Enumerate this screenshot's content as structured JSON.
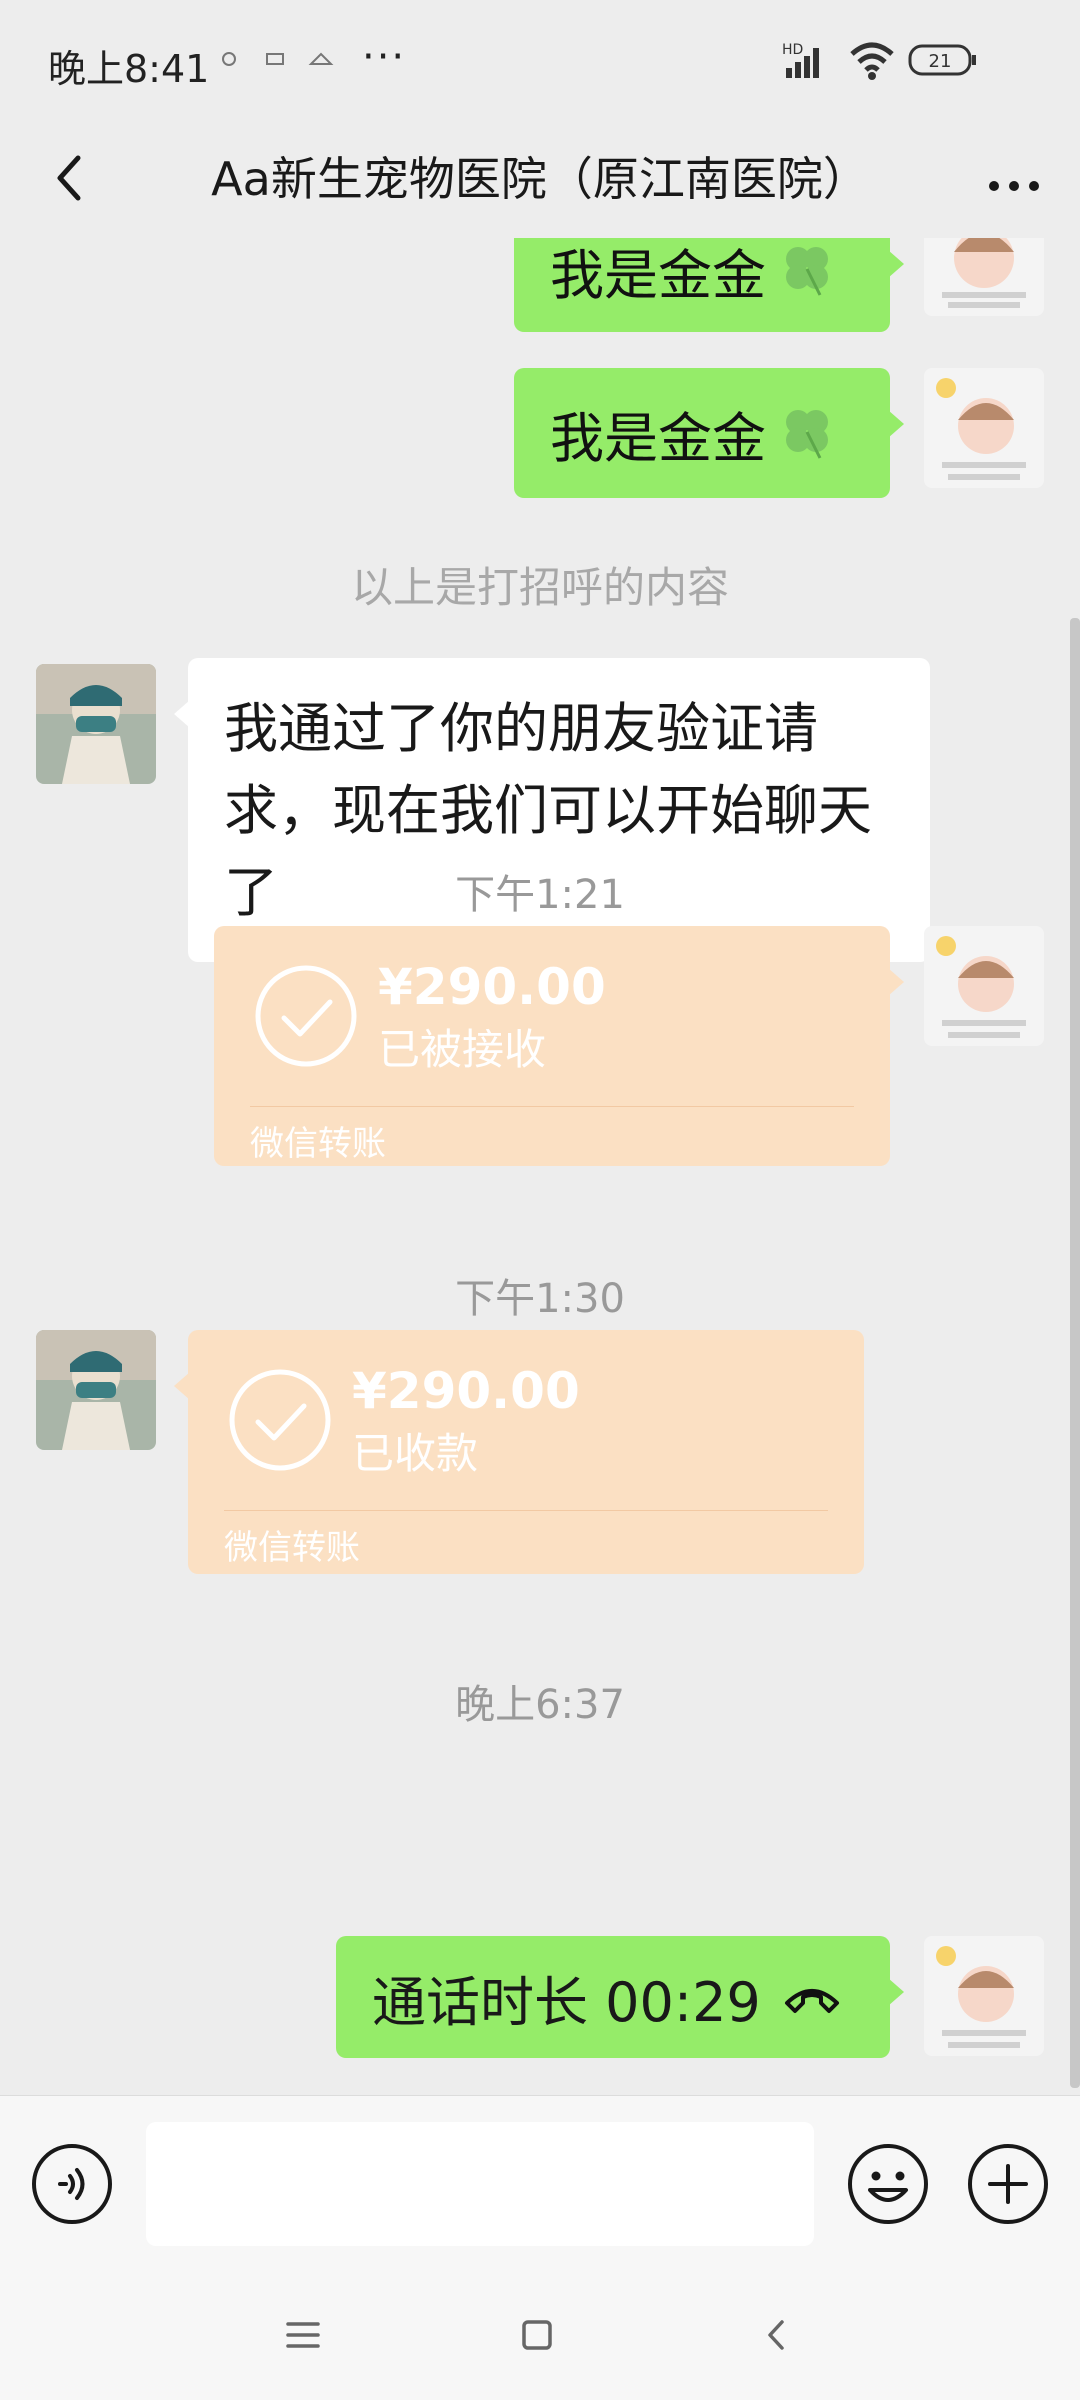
{
  "status_bar": {
    "time": "晚上8:41",
    "more": "···",
    "network": "HD",
    "battery": "21"
  },
  "nav": {
    "title": "Aa新生宠物医院（原江南医院）"
  },
  "chat": {
    "messages_top": [
      {
        "text": "我是金金"
      },
      {
        "text": "我是金金"
      }
    ],
    "greeting_notice": "以上是打招呼的内容",
    "friend_message": "我通过了你的朋友验证请求，现在我们可以开始聊天了",
    "time1": "下午1:21",
    "transfer1": {
      "amount": "¥290.00",
      "status": "已被接收",
      "label": "微信转账"
    },
    "time2": "下午1:30",
    "transfer2": {
      "amount": "¥290.00",
      "status": "已收款",
      "label": "微信转账"
    },
    "time3": "晚上6:37",
    "call": {
      "text": "通话时长 00:29"
    }
  },
  "input": {
    "placeholder": ""
  },
  "colors": {
    "bg": "#ededed",
    "green_bubble": "#95ec69",
    "transfer_bg": "#fbe0c3"
  }
}
